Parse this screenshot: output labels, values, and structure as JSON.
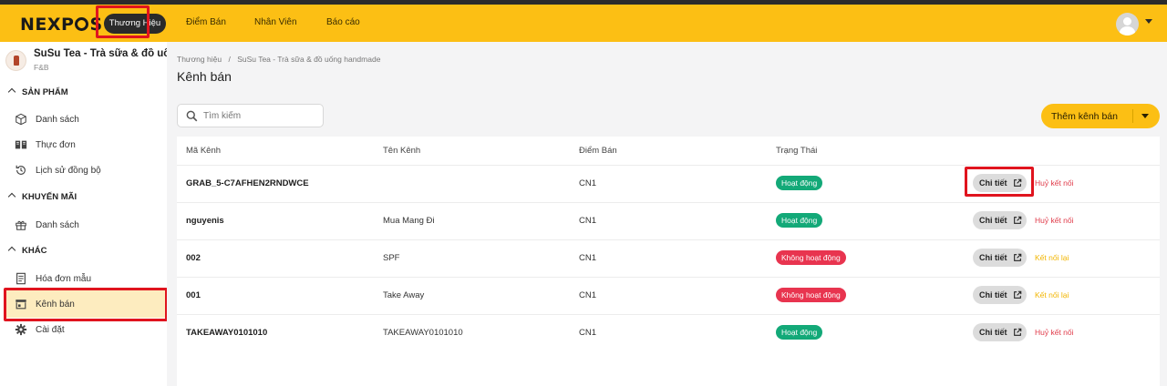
{
  "app": {
    "logo": {
      "prefix": "NEXP",
      "suffix": "S"
    },
    "nav": [
      {
        "label": "Thương Hiệu",
        "active": true
      },
      {
        "label": "Điểm Bán"
      },
      {
        "label": "Nhân Viên"
      },
      {
        "label": "Báo cáo"
      }
    ]
  },
  "sidebar": {
    "brand_name": "SuSu Tea - Trà sữa & đồ uống handmade",
    "brand_type": "F&B",
    "sections": [
      {
        "title": "SẢN PHẨM",
        "items": [
          "Danh sách",
          "Thực đơn",
          "Lịch sử đồng bộ"
        ]
      },
      {
        "title": "KHUYẾN MÃI",
        "items": [
          "Danh sách"
        ]
      },
      {
        "title": "KHÁC",
        "items": [
          "Hóa đơn mẫu",
          "Kênh bán",
          "Cài đặt"
        ]
      }
    ],
    "active_item": "Kênh bán"
  },
  "main": {
    "breadcrumb": [
      "Thương hiệu",
      "SuSu Tea - Trà sữa & đồ uống handmade"
    ],
    "breadcrumb_sep": "/",
    "title": "Kênh bán",
    "search_placeholder": "Tìm kiếm",
    "add_button": "Thêm kênh bán",
    "columns": [
      "Mã Kênh",
      "Tên Kênh",
      "Điểm Bán",
      "Trạng Thái"
    ],
    "detail_label": "Chi tiết",
    "rows": [
      {
        "code": "GRAB_5-C7AFHEN2RNDWCE",
        "name": "",
        "store": "CN1",
        "status": "Hoạt động",
        "status_kind": "on",
        "action": "Huỷ kết nối",
        "action_kind": "red"
      },
      {
        "code": "nguyenis",
        "name": "Mua Mang Đi",
        "store": "CN1",
        "status": "Hoạt động",
        "status_kind": "on",
        "action": "Huỷ kết nối",
        "action_kind": "red"
      },
      {
        "code": "002",
        "name": "SPF",
        "store": "CN1",
        "status": "Không hoạt động",
        "status_kind": "off",
        "action": "Kết nối lại",
        "action_kind": "yellow"
      },
      {
        "code": "001",
        "name": "Take Away",
        "store": "CN1",
        "status": "Không hoạt động",
        "status_kind": "off",
        "action": "Kết nối lại",
        "action_kind": "yellow"
      },
      {
        "code": "TAKEAWAY0101010",
        "name": "TAKEAWAY0101010",
        "store": "CN1",
        "status": "Hoạt động",
        "status_kind": "on",
        "action": "Huỷ kết nối",
        "action_kind": "red"
      }
    ]
  },
  "colors": {
    "accent": "#fcbf14",
    "active_status": "#13a978",
    "inactive_status": "#e8344f",
    "highlight": "#e0141e"
  }
}
